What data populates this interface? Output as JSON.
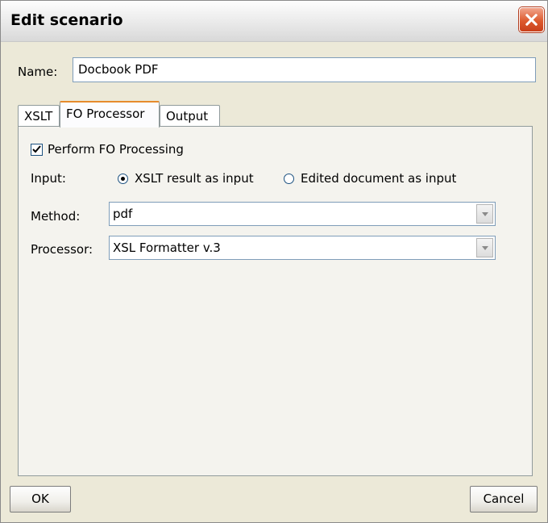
{
  "window": {
    "title": "Edit scenario"
  },
  "name": {
    "label": "Name:",
    "value": "Docbook PDF"
  },
  "tabs": [
    {
      "label": "XSLT",
      "active": false
    },
    {
      "label": "FO Processor",
      "active": true
    },
    {
      "label": "Output",
      "active": false
    }
  ],
  "fo": {
    "perform_label": "Perform FO Processing",
    "perform_checked": true,
    "input_label": "Input:",
    "input_options": [
      {
        "label": "XSLT result as input",
        "checked": true
      },
      {
        "label": "Edited document as input",
        "checked": false
      }
    ],
    "method_label": "Method:",
    "method_value": "pdf",
    "processor_label": "Processor:",
    "processor_value": "XSL Formatter v.3"
  },
  "buttons": {
    "ok": "OK",
    "cancel": "Cancel"
  },
  "icons": {
    "close": "close-icon",
    "checkmark": "checkmark-icon",
    "dropdown": "chevron-down-icon"
  }
}
